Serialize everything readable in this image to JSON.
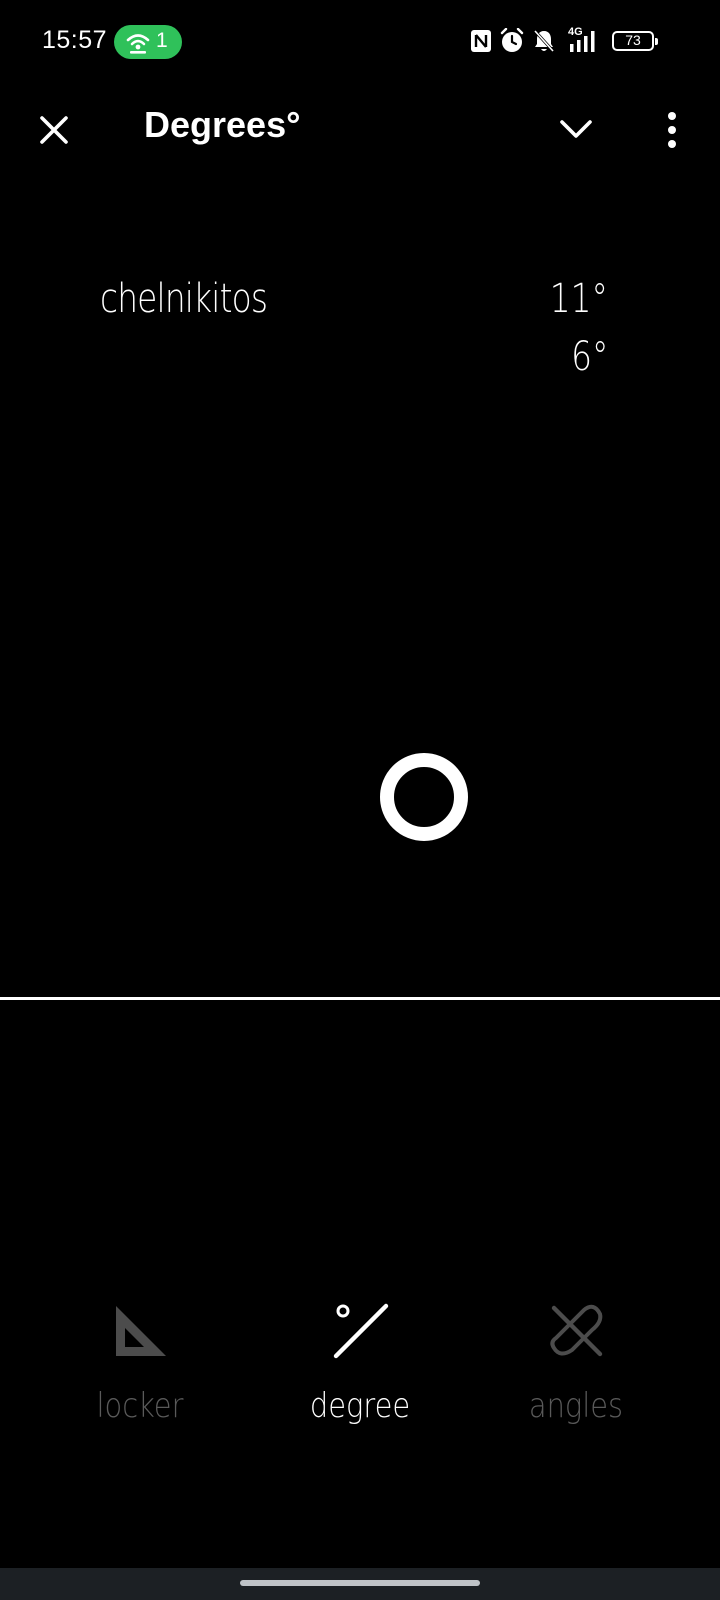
{
  "status_bar": {
    "time": "15:57",
    "hotspot_count": "1",
    "network_label": "4G",
    "battery_level": "73",
    "colors": {
      "hotspot_pill": "#2fc15a"
    },
    "icons": [
      "nfc-icon",
      "alarm-icon",
      "bell-muted-icon",
      "signal-icon",
      "battery-icon"
    ]
  },
  "toolbar": {
    "title": "Degrees°",
    "close_icon": "close-icon",
    "expand_icon": "chevron-down-icon",
    "menu_icon": "more-vert-icon"
  },
  "entry": {
    "name": "chelnikitos",
    "high": "11°",
    "low": "6°"
  },
  "bottom_nav": {
    "items": [
      {
        "label": "locker",
        "icon": "triangle-ruler-icon",
        "active": false
      },
      {
        "label": "degree",
        "icon": "degree-slash-icon",
        "active": true
      },
      {
        "label": "angles",
        "icon": "crossed-lines-icon",
        "active": false
      }
    ]
  }
}
